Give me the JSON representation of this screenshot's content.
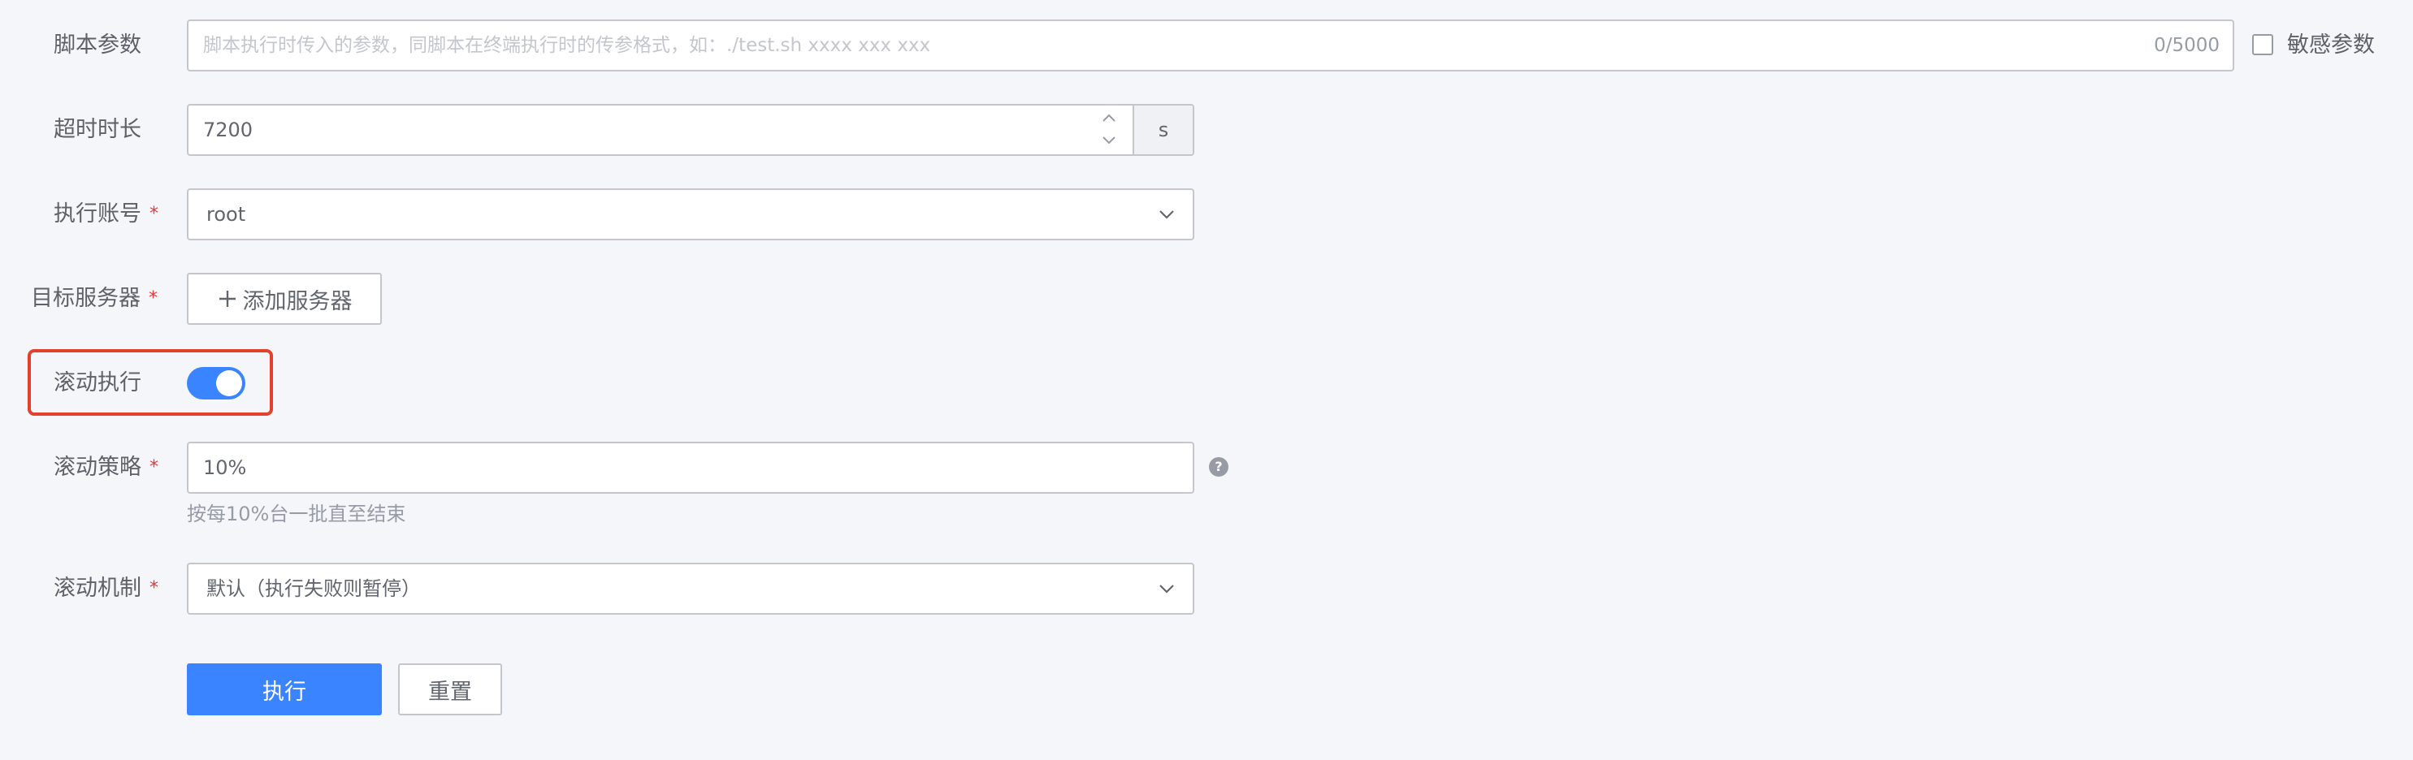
{
  "form": {
    "script_params": {
      "label": "脚本参数",
      "placeholder": "脚本执行时传入的参数，同脚本在终端执行时的传参格式，如：./test.sh xxxx xxx xxx",
      "value": "",
      "counter": "0/5000",
      "sensitive_label": "敏感参数",
      "sensitive_checked": false
    },
    "timeout": {
      "label": "超时时长",
      "value": "7200",
      "unit": "s"
    },
    "account": {
      "label": "执行账号",
      "required_mark": "*",
      "value": "root"
    },
    "target_server": {
      "label": "目标服务器",
      "required_mark": "*",
      "add_button_label": "添加服务器"
    },
    "rolling_exec": {
      "label": "滚动执行",
      "enabled": true
    },
    "rolling_strategy": {
      "label": "滚动策略",
      "required_mark": "*",
      "value": "10%",
      "hint": "按每10%台一批直至结束",
      "help_icon": "question-circle-icon"
    },
    "rolling_mechanism": {
      "label": "滚动机制",
      "required_mark": "*",
      "value": "默认（执行失败则暂停）"
    },
    "actions": {
      "execute_label": "执行",
      "reset_label": "重置"
    }
  },
  "colors": {
    "primary": "#3a84ff",
    "highlight": "#e5402b",
    "required": "#ea3636"
  }
}
